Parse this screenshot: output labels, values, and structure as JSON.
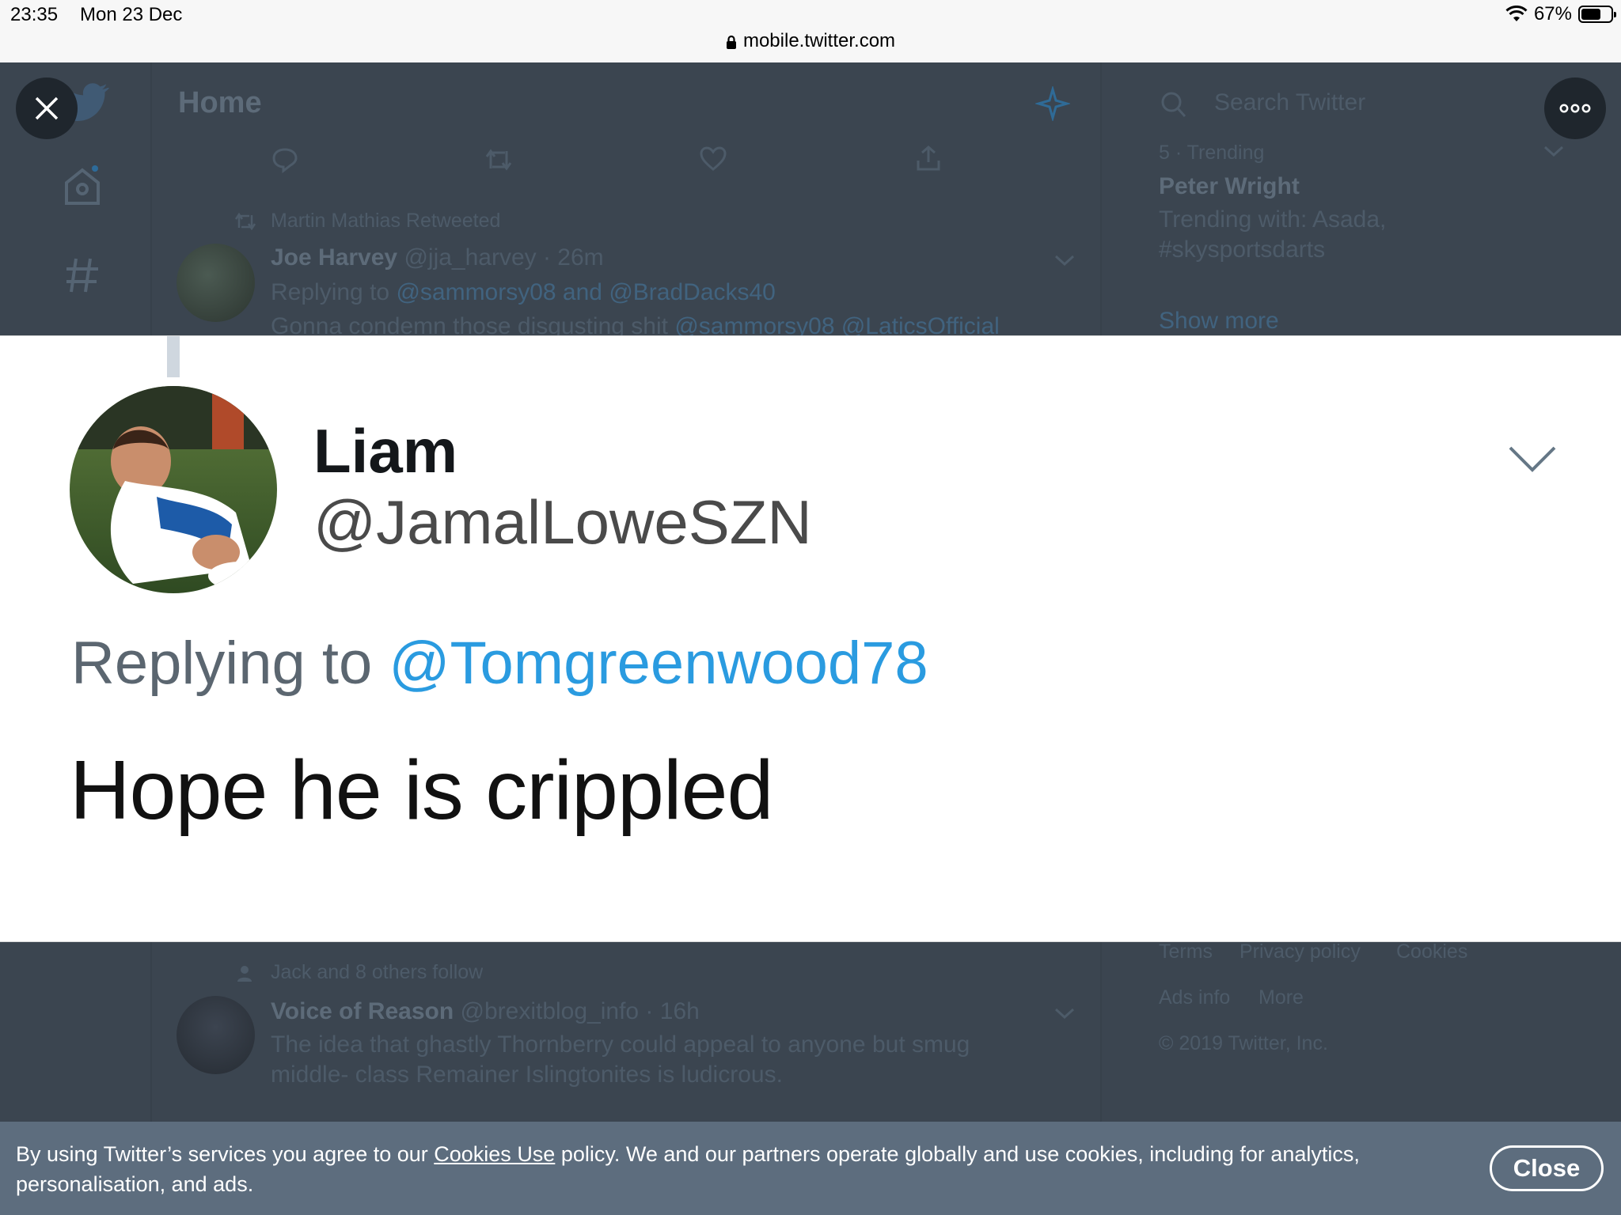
{
  "status_bar": {
    "time": "23:35",
    "date": "Mon 23 Dec",
    "battery": "67%",
    "battery_level": 0.67,
    "url": "mobile.twitter.com"
  },
  "background": {
    "header_title": "Home",
    "search_placeholder": "Search Twitter",
    "trending": {
      "meta": "5 · Trending",
      "title": "Peter Wright",
      "with_line1": "Trending with: Asada,",
      "with_line2": "#skysportsdarts",
      "show_more": "Show more"
    },
    "tweet1": {
      "retweet_note": "Martin Mathias Retweeted",
      "name": "Joe Harvey",
      "handle_time": "@jja_harvey · 26m",
      "reply_prefix": "Replying to",
      "reply_handles": "@sammorsy08 and @BradDacks40",
      "text_start": "Gonna condemn those disgusting shit",
      "text_mentions": "@sammorsy08 @LaticsOfficial"
    },
    "tweet2": {
      "follow_note": "Jack and 8 others follow",
      "name": "Voice of Reason",
      "handle_time": "@brexitblog_info · 16h",
      "text_line1": "The idea that ghastly Thornberry could appeal to anyone but smug",
      "text_line2": "middle- class Remainer Islingtonites is ludicrous."
    },
    "footer": {
      "terms": "Terms",
      "privacy": "Privacy policy",
      "cookies": "Cookies",
      "ads_info": "Ads info",
      "more": "More",
      "copyright": "© 2019 Twitter, Inc."
    }
  },
  "card": {
    "name": "Liam",
    "handle": "@JamalLoweSZN",
    "replying_to": "Replying to",
    "reply_handle": "@Tomgreenwood78",
    "text": "Hope he is crippled"
  },
  "cookie_banner": {
    "text_before": "By using Twitter’s services you agree to our ",
    "link": "Cookies Use",
    "text_after": " policy. We and our partners operate globally and use cookies, including for analytics, personalisation, and ads.",
    "close_label": "Close"
  },
  "icons": [
    "close-icon",
    "more-icon",
    "twitter-logo-icon",
    "home-icon",
    "hashtag-icon",
    "sparkle-icon",
    "search-icon",
    "reply-icon",
    "retweet-icon",
    "like-icon",
    "share-icon",
    "chevron-down-icon",
    "lock-icon",
    "wifi-icon",
    "battery-icon"
  ]
}
